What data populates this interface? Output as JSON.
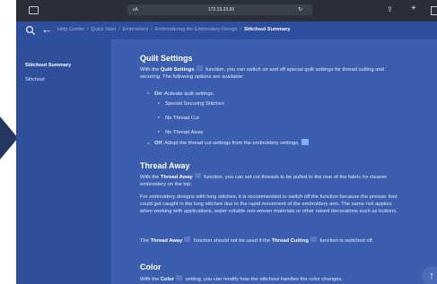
{
  "browser": {
    "text_size": "ᴀA",
    "url": "172.23.33.60",
    "reload_icon": "reload-icon",
    "share_icon": "share-icon",
    "new_tab_icon": "plus-icon",
    "tabs_icon": "tabs-icon"
  },
  "nav": {
    "back_icon": "back-arrow-icon",
    "search_icon": "search-icon",
    "breadcrumb": [
      "Help Center",
      "Quick Start",
      "Embroidery",
      "Embroidering the Embroidery Design",
      "Stitchout Summary"
    ],
    "separator": "/"
  },
  "sidebar": {
    "items": [
      {
        "label": "Stitchout Summary",
        "active": true
      },
      {
        "label": "Stitchout",
        "active": false
      }
    ]
  },
  "content": {
    "quilt": {
      "title": "Quilt Settings",
      "intro_1": "With the ",
      "intro_bold": "Quilt Settings",
      "intro_2": " function, you can switch on and off special quilt settings for thread cutting and securing. The following options are available:",
      "on_label": "On",
      "on_text": ": Activate quilt settings.",
      "sub_items": [
        "Special Securing Stitches",
        "No Thread Cut",
        "No Thread Away"
      ],
      "off_label": "Off",
      "off_text": ": Adopt the thread cut settings from the embroidery settings."
    },
    "thread_away": {
      "title": "Thread Away",
      "p1_a": "With the ",
      "p1_bold": "Thread Away",
      "p1_b": " function, you can set cut threads to be pulled to the rear of the fabric for cleaner embroidery on the top.",
      "p2": "For embroidery designs with long stitches, it is recommended to switch off the function because the presser foot could get caught in the long stitches due to the rapid movement of the embroidery arm. The same risk applies when working with applications, water-soluble non-woven materials or other raised decorations such as buttons.",
      "p3_a": "The ",
      "p3_bold1": "Thread Away",
      "p3_b": " function should not be used if the ",
      "p3_bold2": "Thread Cutting",
      "p3_c": " function is switched off."
    },
    "color": {
      "title": "Color",
      "p1_a": "With the ",
      "p1_bold": "Color",
      "p1_b": " setting, you can modify how the stitchout handles the color changes."
    },
    "scroll_top_icon": "arrow-up-icon"
  },
  "colors": {
    "page_bg": "#3b5fae",
    "sidebar_bg": "#2f4f9a",
    "statusbar_bg": "#2a2f3a",
    "highlight": "#7fb0ff"
  }
}
